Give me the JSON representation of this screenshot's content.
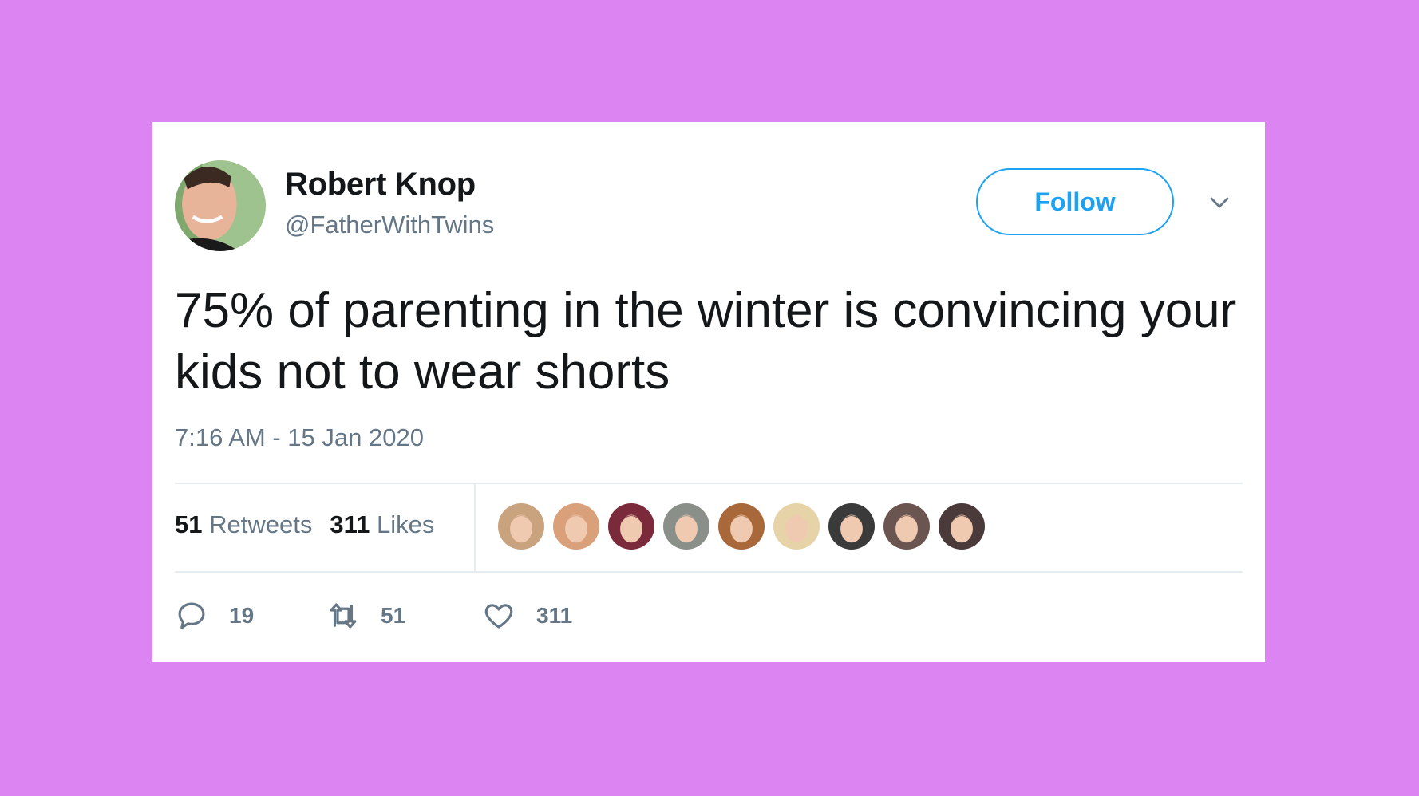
{
  "tweet": {
    "author": {
      "name": "Robert Knop",
      "handle": "@FatherWithTwins",
      "avatar_icon": "profile-photo"
    },
    "follow_label": "Follow",
    "menu_icon": "chevron-down-icon",
    "text": "75% of parenting in the winter is convincing your kids not to wear shorts",
    "timestamp": "7:16 AM - 15 Jan 2020",
    "stats": {
      "retweets_count": "51",
      "retweets_label": "Retweets",
      "likes_count": "311",
      "likes_label": "Likes"
    },
    "liker_avatars": [
      {
        "color": "#c9a27e"
      },
      {
        "color": "#d9a07a"
      },
      {
        "color": "#7a2a3a"
      },
      {
        "color": "#8a8f8a"
      },
      {
        "color": "#a8683a"
      },
      {
        "color": "#e6d3a8"
      },
      {
        "color": "#3a3a3a"
      },
      {
        "color": "#6b5550"
      },
      {
        "color": "#4a3a3a"
      }
    ],
    "actions": {
      "reply_count": "19",
      "retweet_count": "51",
      "like_count": "311"
    }
  },
  "colors": {
    "background": "#dc84f2",
    "accent": "#1da1f2",
    "text": "#14171a",
    "muted": "#657786"
  }
}
